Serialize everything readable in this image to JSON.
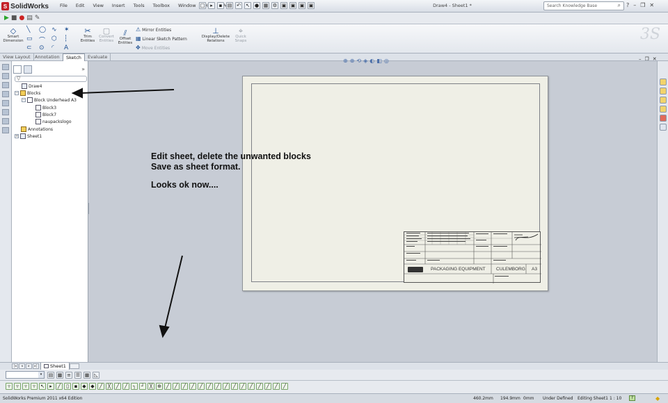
{
  "app": {
    "name": "SolidWorks",
    "document_title": "Draw4 - Sheet1 *"
  },
  "menu": [
    "File",
    "Edit",
    "View",
    "Insert",
    "Tools",
    "Toolbox",
    "Window",
    "Help"
  ],
  "search": {
    "placeholder": "Search Knowledge Base"
  },
  "command_manager": {
    "smart_dimension": "Smart\nDimension",
    "trim": "Trim\nEntities",
    "convert": "Convert\nEntities",
    "offset": "Offset\nEntities",
    "mirror": "Mirror Entities",
    "linear_pattern": "Linear Sketch Pattern",
    "move": "Move Entities",
    "display_delete": "Display/Delete\nRelations",
    "quick_snaps": "Quick\nSnaps"
  },
  "tabs": [
    {
      "label": "View Layout",
      "active": false
    },
    {
      "label": "Annotation",
      "active": false
    },
    {
      "label": "Sketch",
      "active": true
    },
    {
      "label": "Evaluate",
      "active": false
    }
  ],
  "tree": {
    "root": "Draw4",
    "blocks": "Blocks",
    "block_folder": "Block Underhead A3",
    "block_a": "Block3",
    "block_b": "Block7",
    "block_c": "naupackslogo",
    "annotations": "Annotations",
    "sheet": "Sheet1"
  },
  "note": {
    "line1": "Edit sheet, delete the unwanted blocks",
    "line2": "Save as sheet format.",
    "line3": "Looks ok now...."
  },
  "title_block": {
    "company": "PACKAGING EQUIPMENT",
    "city": "CULEMBORG",
    "size": "A3"
  },
  "sheet_tab": {
    "label": "Sheet1"
  },
  "status": {
    "edition": "SolidWorks Premium 2011 x64 Edition",
    "x": "460.2mm",
    "y": "194.9mm",
    "z": "0mm",
    "state": "Under Defined",
    "editing": "Editing Sheet1",
    "scale": "1 : 10",
    "help": "?"
  },
  "colors": {
    "app_red": "#c42028",
    "graphics_bg": "#c7ccd5",
    "sheet_bg": "#efefe6",
    "accent_blue": "#1d4f91"
  }
}
